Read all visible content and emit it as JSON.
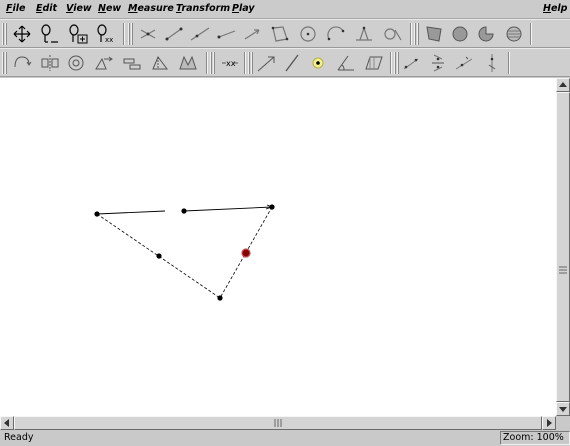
{
  "menubar": {
    "items": [
      {
        "label": "File",
        "key": "F",
        "rest": "ile"
      },
      {
        "label": "Edit",
        "key": "E",
        "rest": "dit"
      },
      {
        "label": "View",
        "key": "V",
        "rest": "iew"
      },
      {
        "label": "New",
        "key": "N",
        "rest": "ew"
      },
      {
        "label": "Measure",
        "key": "M",
        "rest": "easure"
      },
      {
        "label": "Transform",
        "key": "T",
        "rest": "ransform"
      },
      {
        "label": "Play",
        "key": "P",
        "rest": "lay"
      }
    ],
    "help": {
      "label": "Help",
      "key": "H",
      "rest": "elp"
    }
  },
  "toolbar1": {
    "tools": [
      "move-tool-icon",
      "label-tool-icon",
      "label-all-icon",
      "label-text-icon",
      "intersection-icon",
      "segment-icon",
      "line-icon",
      "ray-icon",
      "vector-icon",
      "polygon-icon",
      "circle-icon",
      "arc-icon",
      "locus-icon",
      "tangent-icon",
      "polygon-fill-icon",
      "circle-fill-icon",
      "sector-fill-icon",
      "segment-fill-icon"
    ]
  },
  "toolbar2": {
    "tools": [
      "rotate-icon",
      "reflect-icon",
      "dilate-icon",
      "translate-icon",
      "similar-icon",
      "shear-icon",
      "animate-icon",
      "symmetry-icon",
      "angle-bisector-icon",
      "perpendicular-icon",
      "point-icon",
      "angle-icon",
      "parallelogram-icon",
      "measure-1-icon",
      "measure-2-icon",
      "measure-3-icon",
      "measure-4-icon"
    ]
  },
  "status": {
    "left": "Ready",
    "zoom": "Zoom: 100%"
  },
  "colors": {
    "selected_point": "#8b0000",
    "window_bg": "#c9c9c9",
    "canvas_bg": "#ffffff"
  }
}
